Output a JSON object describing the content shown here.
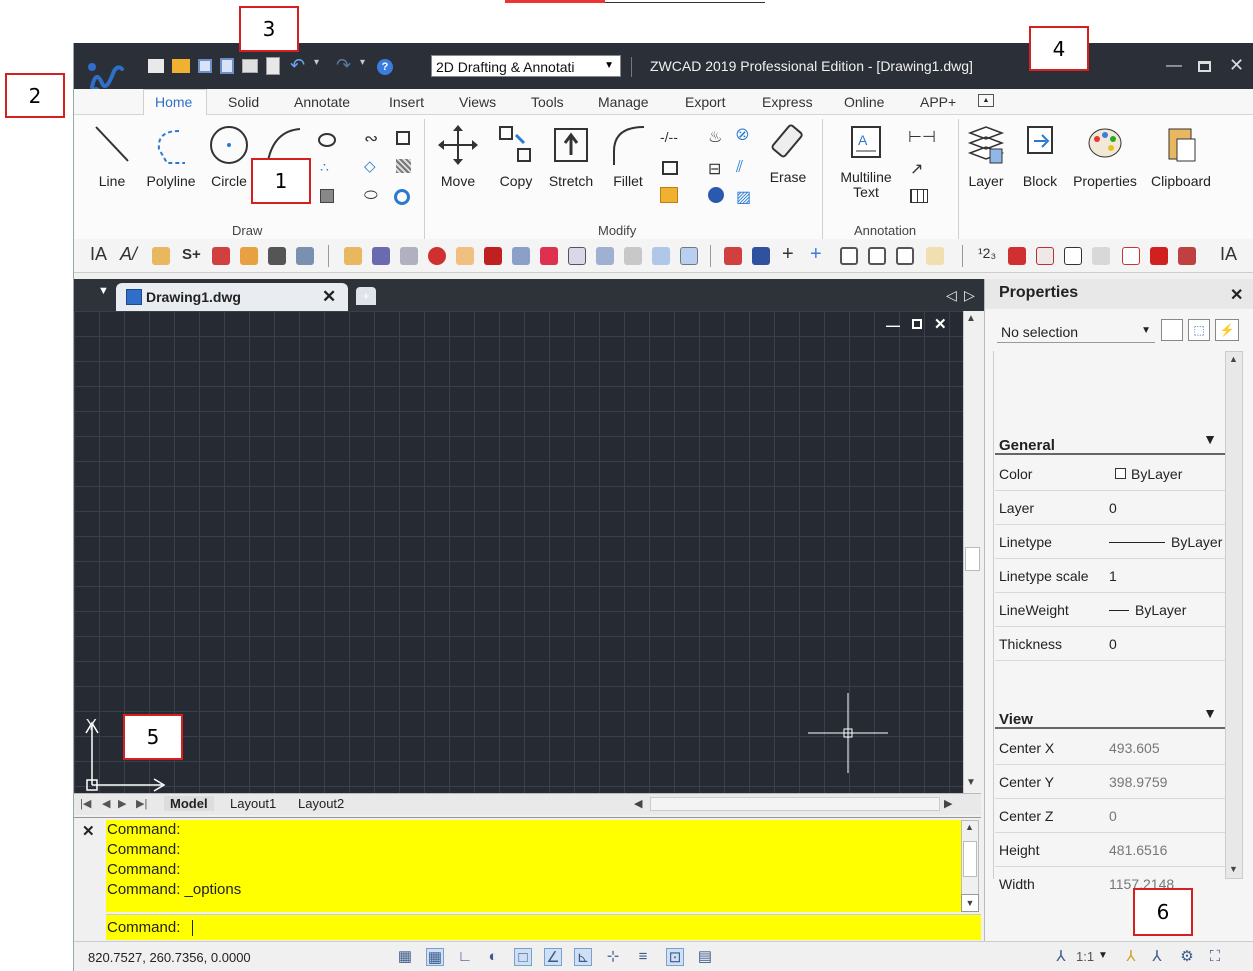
{
  "callouts": [
    "1",
    "2",
    "3",
    "4",
    "5",
    "6"
  ],
  "app": {
    "workspace": "2D Drafting & Annotati",
    "title": "ZWCAD 2019 Professional Edition - [Drawing1.dwg]"
  },
  "ribbon_tabs": [
    "Home",
    "Solid",
    "Annotate",
    "Insert",
    "Views",
    "Tools",
    "Manage",
    "Export",
    "Express",
    "Online",
    "APP+"
  ],
  "draw_group": {
    "label": "Draw",
    "line": "Line",
    "polyline": "Polyline",
    "circle": "Circle"
  },
  "modify_group": {
    "label": "Modify",
    "move": "Move",
    "copy": "Copy",
    "stretch": "Stretch",
    "fillet": "Fillet",
    "erase": "Erase"
  },
  "annotation_group": {
    "label": "Annotation",
    "mtext_1": "Multiline",
    "mtext_2": "Text"
  },
  "big_tools": {
    "layer": "Layer",
    "block": "Block",
    "properties": "Properties",
    "clipboard": "Clipboard"
  },
  "document": {
    "tab": "Drawing1.dwg"
  },
  "canvas": {
    "axis_y": "Y",
    "axis_x": "X"
  },
  "layouts": [
    "Model",
    "Layout1",
    "Layout2"
  ],
  "command": {
    "history": [
      "Command:",
      "Command:",
      "Command:",
      "Command: _options"
    ],
    "prompt": "Command:"
  },
  "status": {
    "coords": "820.7527, 260.7356, 0.0000",
    "scale": "1:1"
  },
  "properties": {
    "title": "Properties",
    "selection": "No selection",
    "general_header": "General",
    "general": [
      {
        "key": "Color",
        "value": "ByLayer"
      },
      {
        "key": "Layer",
        "value": "0"
      },
      {
        "key": "Linetype",
        "value": "ByLayer"
      },
      {
        "key": "Linetype scale",
        "value": "1"
      },
      {
        "key": "LineWeight",
        "value": "ByLayer"
      },
      {
        "key": "Thickness",
        "value": "0"
      }
    ],
    "view_header": "View",
    "view": [
      {
        "key": "Center X",
        "value": "493.605"
      },
      {
        "key": "Center Y",
        "value": "398.9759"
      },
      {
        "key": "Center Z",
        "value": "0"
      },
      {
        "key": "Height",
        "value": "481.6516"
      },
      {
        "key": "Width",
        "value": "1157.2148"
      }
    ]
  },
  "colors": {
    "titlebar": "#2b3038",
    "canvas": "#262b33",
    "grid": "#3a4049",
    "command_bg": "#ffff00",
    "accent": "#2f6fc9"
  }
}
